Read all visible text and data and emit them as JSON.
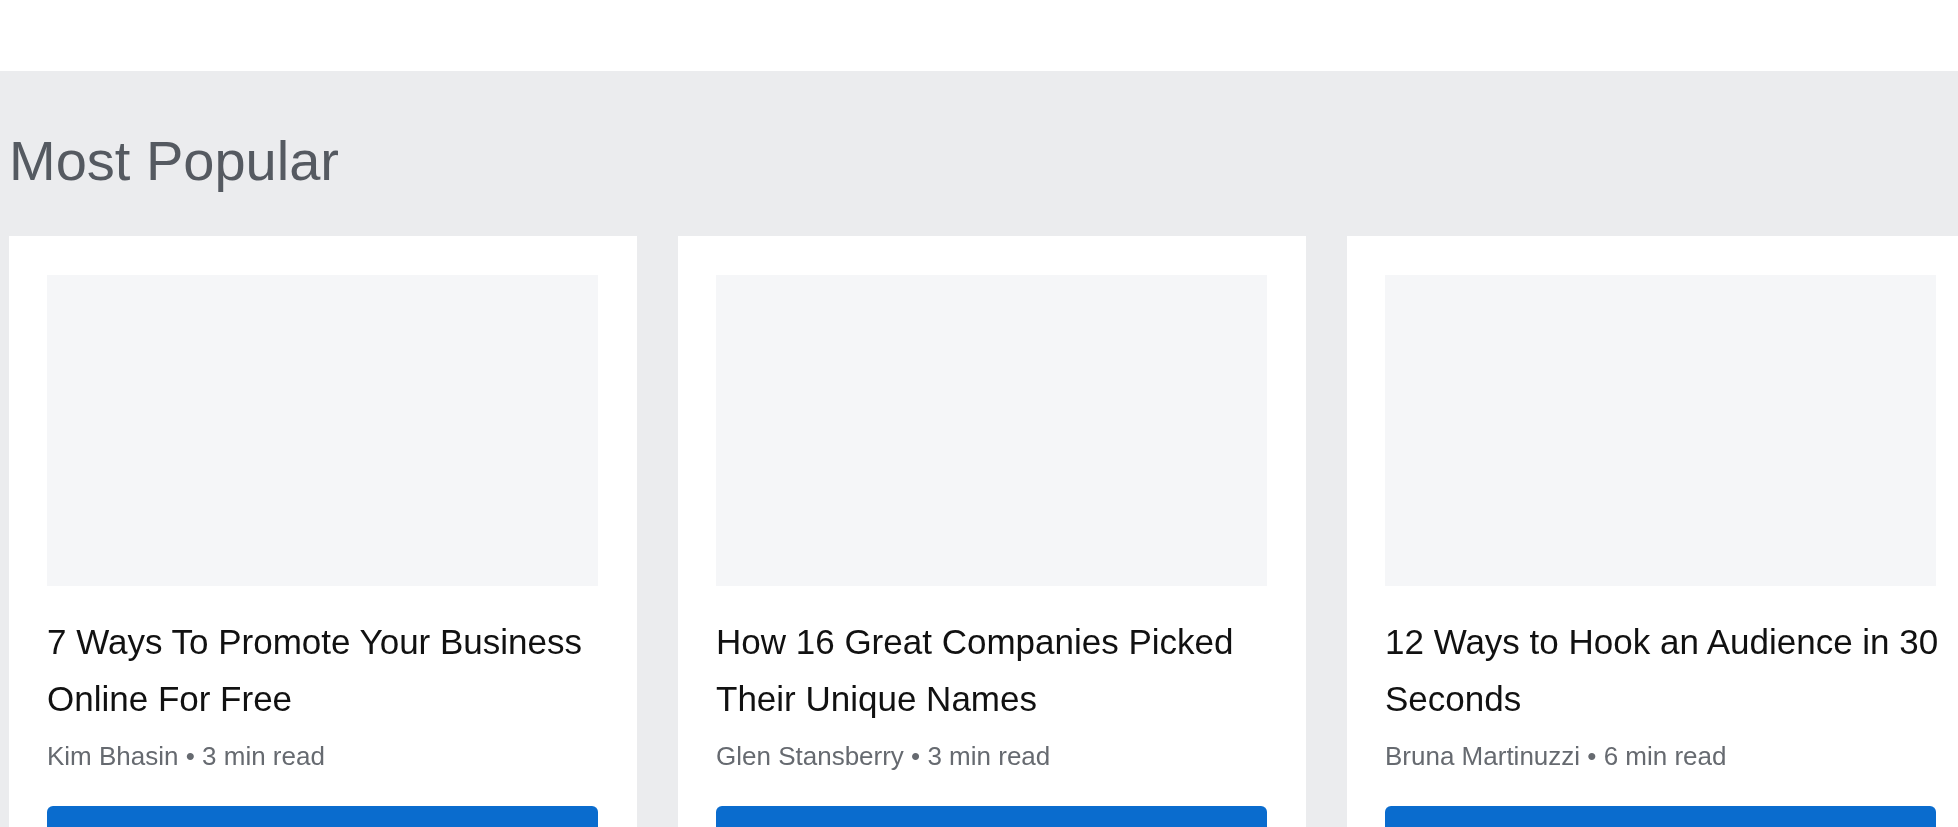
{
  "section": {
    "title": "Most Popular"
  },
  "cards": [
    {
      "headline": "7 Ways To Promote Your Business Online For Free",
      "meta": "Kim Bhasin • 3 min read"
    },
    {
      "headline": "How 16 Great Companies Picked Their Unique Names",
      "meta": "Glen Stansberry • 3 min read"
    },
    {
      "headline": "12 Ways to Hook an Audience in 30 Seconds",
      "meta": "Bruna Martinuzzi • 6 min read"
    }
  ]
}
